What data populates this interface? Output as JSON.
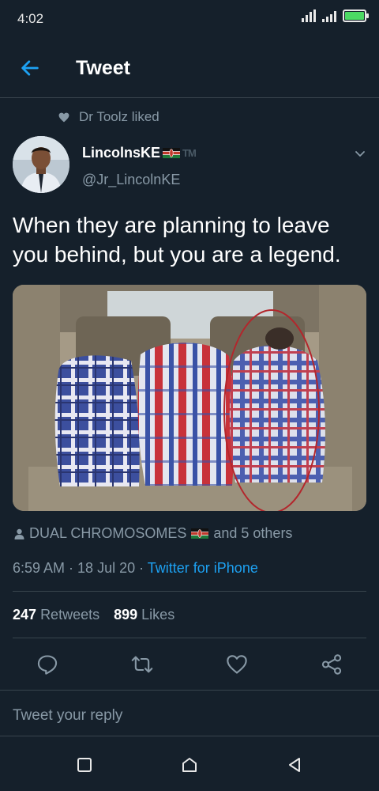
{
  "status_bar": {
    "time": "4:02"
  },
  "header": {
    "title": "Tweet"
  },
  "social_context": {
    "text": "Dr Toolz liked"
  },
  "tweet": {
    "author_name": "LincolnsKE",
    "author_suffix": "TM",
    "author_handle": "@Jr_LincolnKE",
    "text": "When they are planning to leave you behind, but you are a legend.",
    "retweeted_by_name": "DUAL CHROMOSOMES",
    "retweeted_by_rest": "and 5 others",
    "time": "6:59 AM",
    "date": "18 Jul 20",
    "separator": " · ",
    "source": "Twitter for iPhone",
    "retweet_count": "247",
    "retweet_label": "Retweets",
    "like_count": "899",
    "like_label": "Likes"
  },
  "reply": {
    "placeholder": "Tweet your reply"
  },
  "icons": {
    "back": "arrow-left-icon",
    "liked": "heart-icon",
    "caret": "chevron-down-icon",
    "person": "person-icon",
    "reply": "comment-icon",
    "retweet": "retweet-icon",
    "like": "heart-icon",
    "share": "share-icon",
    "nav_recents": "square-icon",
    "nav_home": "home-icon",
    "nav_back": "triangle-back-icon"
  },
  "colors": {
    "background": "#15202b",
    "accent": "#1da1f2",
    "secondary_text": "#8899a6",
    "divider": "#38444d"
  }
}
